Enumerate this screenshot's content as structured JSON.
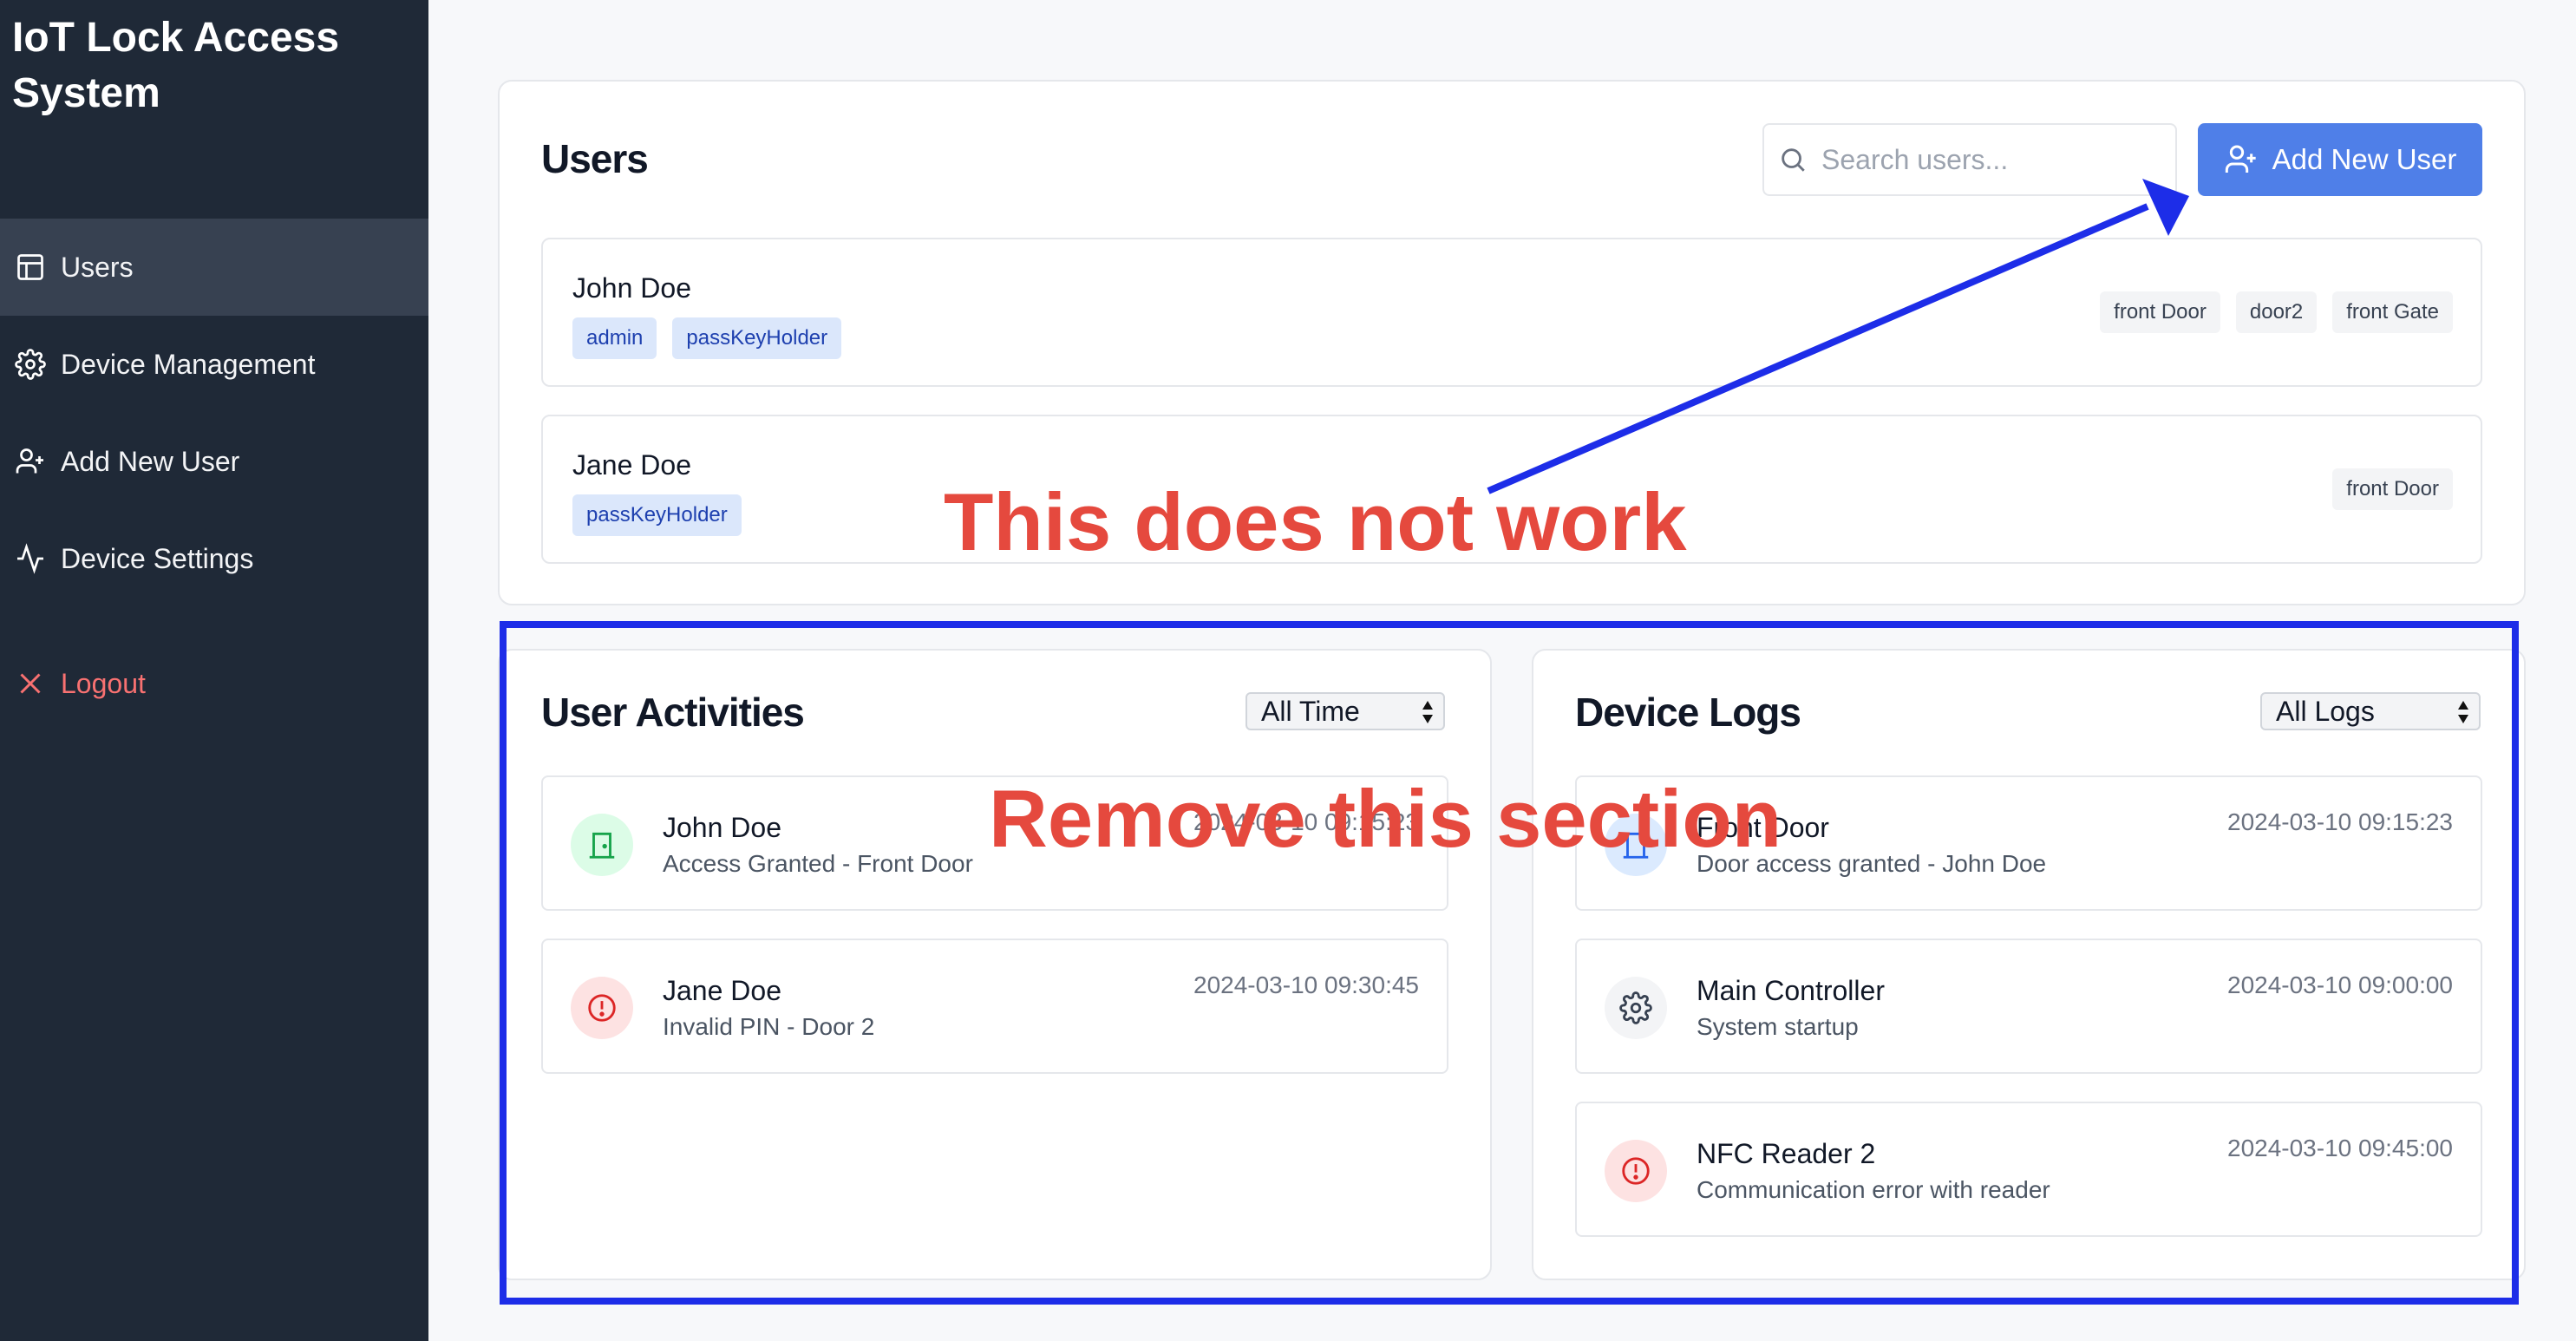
{
  "sidebar": {
    "brand": "IoT Lock Access System",
    "items": [
      {
        "label": "Users",
        "icon": "table-icon"
      },
      {
        "label": "Device Management",
        "icon": "gear-icon"
      },
      {
        "label": "Add New User",
        "icon": "user-plus-icon"
      },
      {
        "label": "Device Settings",
        "icon": "activity-icon"
      },
      {
        "label": "Logout",
        "icon": "close-icon"
      }
    ]
  },
  "users_panel": {
    "title": "Users",
    "search_placeholder": "Search users...",
    "add_button_label": "Add New User",
    "users": [
      {
        "name": "John Doe",
        "roles": [
          "admin",
          "passKeyHolder"
        ],
        "doors": [
          "front Door",
          "door2",
          "front Gate"
        ]
      },
      {
        "name": "Jane Doe",
        "roles": [
          "passKeyHolder"
        ],
        "doors": [
          "front Door"
        ]
      }
    ]
  },
  "activities": {
    "title": "User Activities",
    "filter": "All Time",
    "items": [
      {
        "name": "John Doe",
        "detail": "Access Granted - Front Door",
        "time": "2024-03-10 09:15:23",
        "icon": "door-icon"
      },
      {
        "name": "Jane Doe",
        "detail": "Invalid PIN - Door 2",
        "time": "2024-03-10 09:30:45",
        "icon": "alert-circle-icon"
      }
    ]
  },
  "device_logs": {
    "title": "Device Logs",
    "filter": "All Logs",
    "items": [
      {
        "name": "Front Door",
        "detail": "Door access granted - John Doe",
        "time": "2024-03-10 09:15:23",
        "icon": "door-icon"
      },
      {
        "name": "Main Controller",
        "detail": "System startup",
        "time": "2024-03-10 09:00:00",
        "icon": "gear-icon"
      },
      {
        "name": "NFC Reader 2",
        "detail": "Communication error with reader",
        "time": "2024-03-10 09:45:00",
        "icon": "alert-circle-icon"
      }
    ]
  },
  "annotations": {
    "note1": "This does not work",
    "note2": "Remove this section",
    "arrow_color": "#1d2de8",
    "text_color": "#e5493e"
  },
  "colors": {
    "sidebar_bg": "#1f2937",
    "accent": "#4f7fe8",
    "logout": "#f87171"
  }
}
